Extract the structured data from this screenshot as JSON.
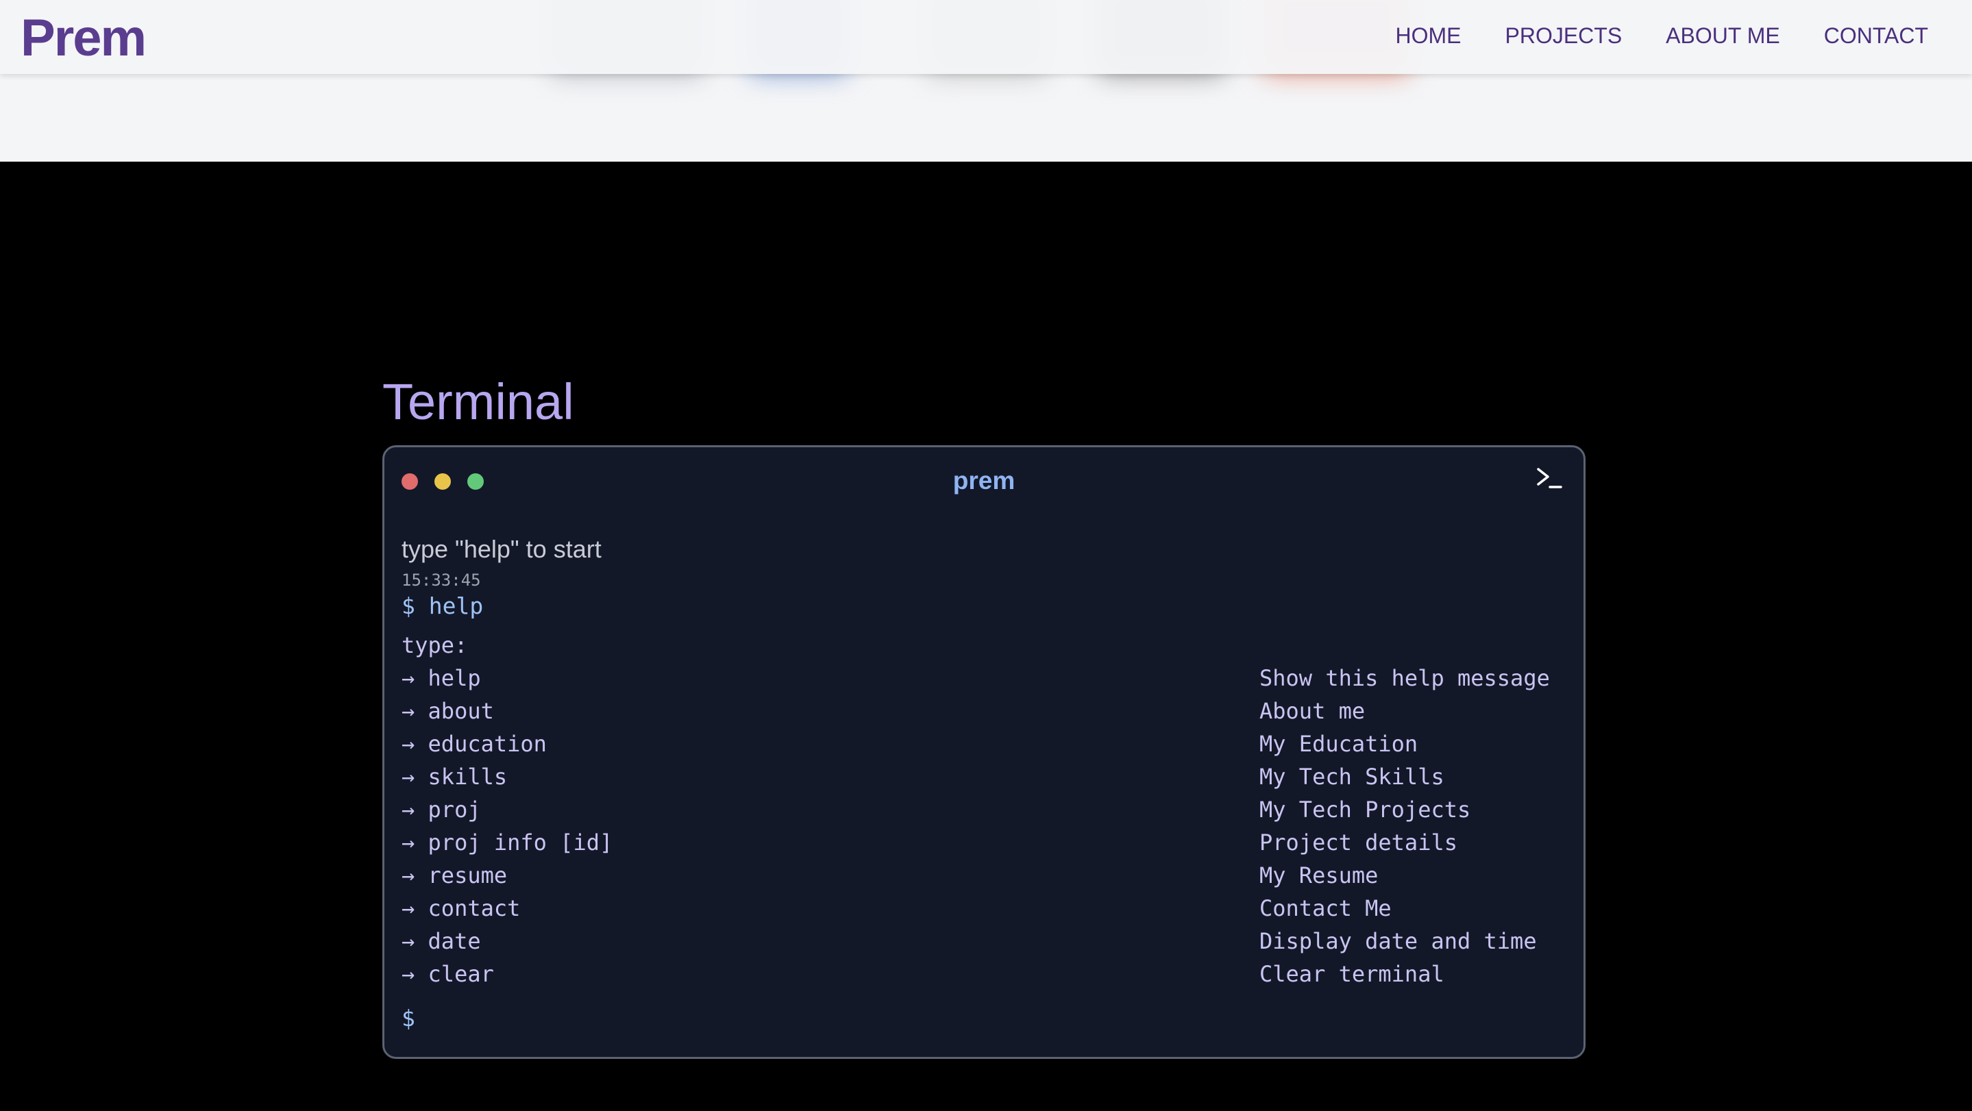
{
  "brand": {
    "name": "Prem"
  },
  "nav": {
    "items": [
      {
        "label": "HOME"
      },
      {
        "label": "PROJECTS"
      },
      {
        "label": "ABOUT ME"
      },
      {
        "label": "CONTACT"
      }
    ]
  },
  "section": {
    "title": "Terminal"
  },
  "terminal": {
    "title": "prem",
    "welcome": "type \"help\" to start",
    "timestamp": "15:33:45",
    "command": "$ help",
    "type_label": "type:",
    "prompt": "$",
    "input_value": "",
    "help": [
      {
        "cmd": "→ help",
        "desc": "Show this help message"
      },
      {
        "cmd": "→ about",
        "desc": "About me"
      },
      {
        "cmd": "→ education",
        "desc": "My Education"
      },
      {
        "cmd": "→ skills",
        "desc": "My Tech Skills"
      },
      {
        "cmd": "→ proj",
        "desc": "My Tech Projects"
      },
      {
        "cmd": "→ proj info [id]",
        "desc": "Project details"
      },
      {
        "cmd": "→ resume",
        "desc": "My Resume"
      },
      {
        "cmd": "→ contact",
        "desc": "Contact Me"
      },
      {
        "cmd": "→ date",
        "desc": "Display date and time"
      },
      {
        "cmd": "→ clear",
        "desc": "Clear terminal"
      }
    ]
  },
  "colors": {
    "brand": "#5a3d8f",
    "nav_text": "#4b2f7d",
    "section_title": "#b7a6f0",
    "terminal_bg": "#131829",
    "terminal_text": "#c9c4f1",
    "terminal_accent": "#8fb4f2",
    "dot_red": "#e06c6c",
    "dot_yellow": "#e8c54a",
    "dot_green": "#62c97a"
  }
}
